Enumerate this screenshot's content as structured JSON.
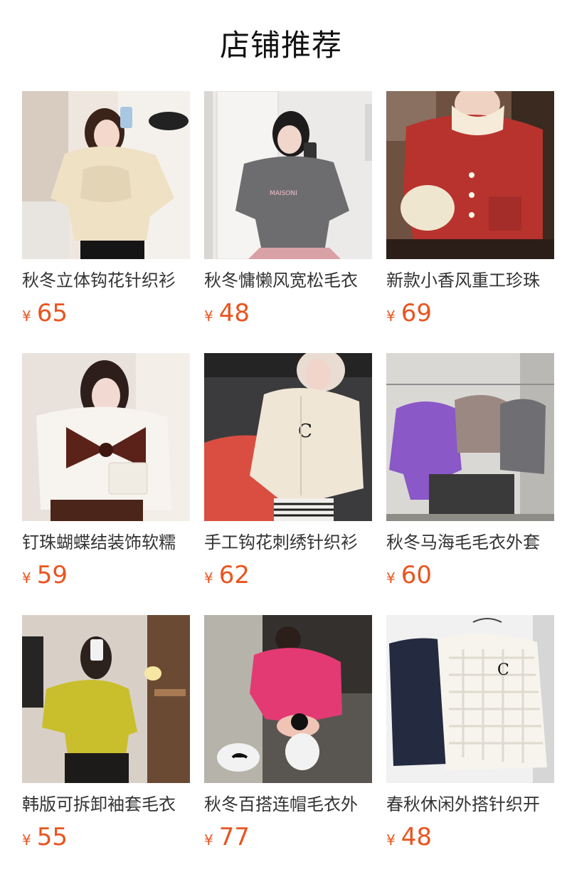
{
  "page": {
    "title": "店铺推荐",
    "currency_symbol": "¥"
  },
  "colors": {
    "price": "#e8551f",
    "text": "#333333"
  },
  "products": [
    {
      "name": "秋冬立体钩花针织衫",
      "price": "65",
      "image": "cream-sweater-photo",
      "palette": [
        "#efe7df",
        "#efe1c4",
        "#1c1c1c"
      ]
    },
    {
      "name": "秋冬慵懒风宽松毛衣",
      "price": "48",
      "image": "gray-sweater-photo",
      "palette": [
        "#e8e6e4",
        "#6d6d70",
        "#d8a1a6"
      ]
    },
    {
      "name": "新款小香风重工珍珠",
      "price": "69",
      "image": "red-cardigan-photo",
      "palette": [
        "#6e5140",
        "#b8332d",
        "#f6ead8"
      ]
    },
    {
      "name": "钉珠蝴蝶结装饰软糯",
      "price": "59",
      "image": "white-bow-cardigan-photo",
      "palette": [
        "#e9e1dc",
        "#f7f3ee",
        "#5a2219"
      ]
    },
    {
      "name": "手工钩花刺绣针织衫",
      "price": "62",
      "image": "cream-zip-cardigan-photo",
      "palette": [
        "#3b3b3d",
        "#efe6d6",
        "#111111"
      ]
    },
    {
      "name": "秋冬马海毛毛衣外套",
      "price": "60",
      "image": "mohair-sweaters-photo",
      "palette": [
        "#d9d8d5",
        "#8a58c7",
        "#6f6f73"
      ]
    },
    {
      "name": "韩版可拆卸袖套毛衣",
      "price": "55",
      "image": "yellow-sweater-photo",
      "palette": [
        "#d8d0c6",
        "#c9be2c",
        "#2a2222"
      ]
    },
    {
      "name": "秋冬百搭连帽毛衣外",
      "price": "77",
      "image": "pink-hoodie-photo",
      "palette": [
        "#7e7c78",
        "#e33a74",
        "#f2f2f2"
      ]
    },
    {
      "name": "春秋休闲外搭针织开",
      "price": "48",
      "image": "knit-cardigans-photo",
      "palette": [
        "#f1f1f1",
        "#242a3f",
        "#f6f4ec"
      ]
    }
  ]
}
